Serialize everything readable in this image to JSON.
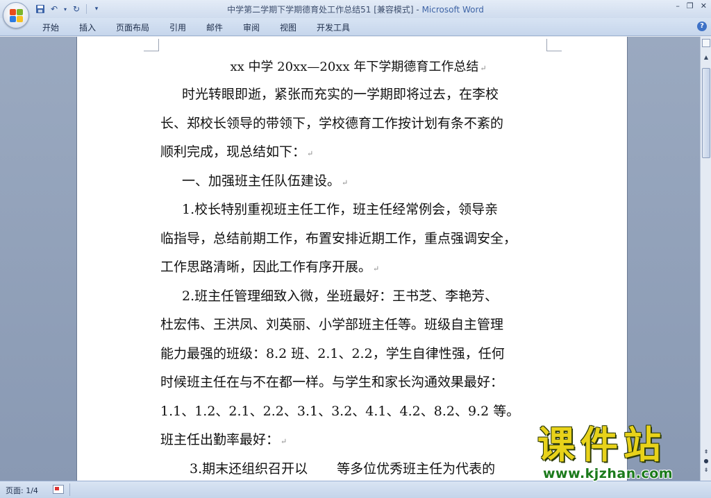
{
  "window": {
    "title_doc": "中学第二学期下学期德育处工作总结51 [兼容模式]",
    "title_sep": " - ",
    "title_app": "Microsoft Word",
    "controls": [
      "–",
      "❐",
      "✕"
    ]
  },
  "quick_access": {
    "save_icon": "save-icon",
    "undo_icon": "undo-icon",
    "redo_icon": "redo-icon",
    "customize": "▾"
  },
  "ribbon": {
    "tabs": [
      "开始",
      "插入",
      "页面布局",
      "引用",
      "邮件",
      "审阅",
      "视图",
      "开发工具"
    ],
    "help": "?"
  },
  "document": {
    "title": "xx 中学 20xx—20xx 年下学期德育工作总结",
    "lines": [
      {
        "text": "时光转眼即逝，紧张而充实的一学期即将过去，在李校",
        "indent": true,
        "mark": false
      },
      {
        "text": "长、郑校长领导的带领下，学校德育工作按计划有条不紊的",
        "indent": false,
        "mark": false
      },
      {
        "text": "顺利完成，现总结如下：",
        "indent": false,
        "mark": true
      },
      {
        "text": "一、加强班主任队伍建设。",
        "indent": true,
        "mark": true
      },
      {
        "text": "1.校长特别重视班主任工作，班主任经常例会，领导亲",
        "indent": true,
        "mark": false
      },
      {
        "text": "临指导，总结前期工作，布置安排近期工作，重点强调安全，",
        "indent": false,
        "mark": false
      },
      {
        "text": "工作思路清晰，因此工作有序开展。",
        "indent": false,
        "mark": true
      },
      {
        "text": "2.班主任管理细致入微，坐班最好：王书芝、李艳芳、",
        "indent": true,
        "mark": false
      },
      {
        "text": "杜宏伟、王洪凤、刘英丽、小学部班主任等。班级自主管理",
        "indent": false,
        "mark": false
      },
      {
        "text": "能力最强的班级：8.2 班、2.1、2.2，学生自律性强，任何",
        "indent": false,
        "mark": false
      },
      {
        "text": "时候班主任在与不在都一样。与学生和家长沟通效果最好：",
        "indent": false,
        "mark": false
      },
      {
        "text": "1.1、1.2、2.1、2.2、3.1、3.2、4.1、4.2、8.2、9.2 等。",
        "indent": false,
        "mark": false
      },
      {
        "text": "班主任出勤率最好：",
        "indent": false,
        "mark": true
      }
    ],
    "last_line_a": "3.期末还组织召开以",
    "last_line_b": "等多位优秀班主任为代表的",
    "paragraph_mark": "↵"
  },
  "statusbar": {
    "page": "页面: 1/4"
  },
  "watermark": {
    "brand": "课件站",
    "url": "www.kjzhan.com"
  }
}
